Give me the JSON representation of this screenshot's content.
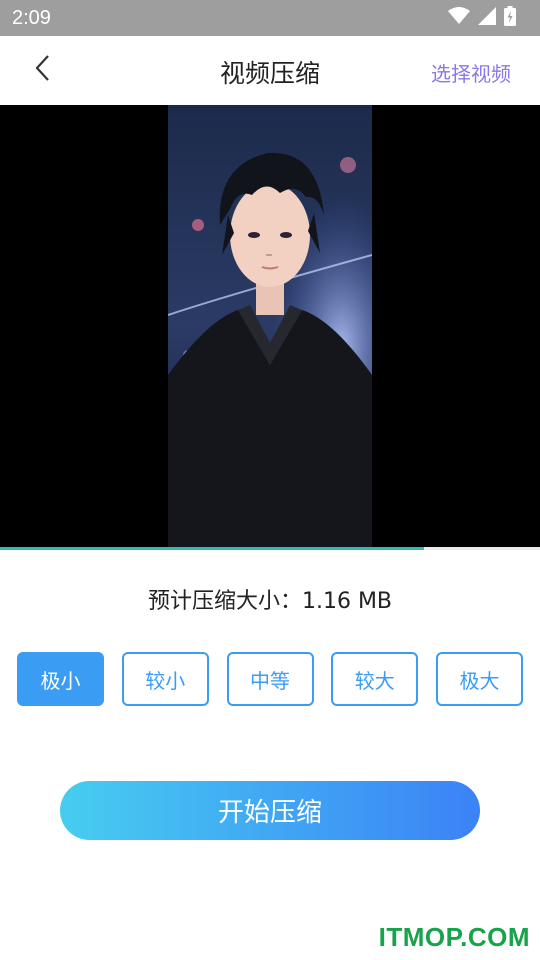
{
  "status_bar": {
    "time": "2:09",
    "icons": [
      "wifi-icon",
      "signal-icon",
      "battery-icon"
    ]
  },
  "header": {
    "back_icon": "chevron-left-icon",
    "title": "视频压缩",
    "action_label": "选择视频"
  },
  "video": {
    "playback_progress": 0.786
  },
  "estimate": {
    "text": "预计压缩大小：1.16 MB"
  },
  "options": [
    {
      "label": "极小",
      "selected": true
    },
    {
      "label": "较小",
      "selected": false
    },
    {
      "label": "中等",
      "selected": false
    },
    {
      "label": "较大",
      "selected": false
    },
    {
      "label": "极大",
      "selected": false
    }
  ],
  "start_button": {
    "label": "开始压缩"
  },
  "watermark": {
    "text": "ITMOP.COM"
  },
  "colors": {
    "accent": "#3b9cf4",
    "action_text": "#8b78e6",
    "progress": "#2bbdb2",
    "gradient_start": "#47cdf0",
    "gradient_end": "#3b82f6",
    "watermark": "#16a34a"
  }
}
